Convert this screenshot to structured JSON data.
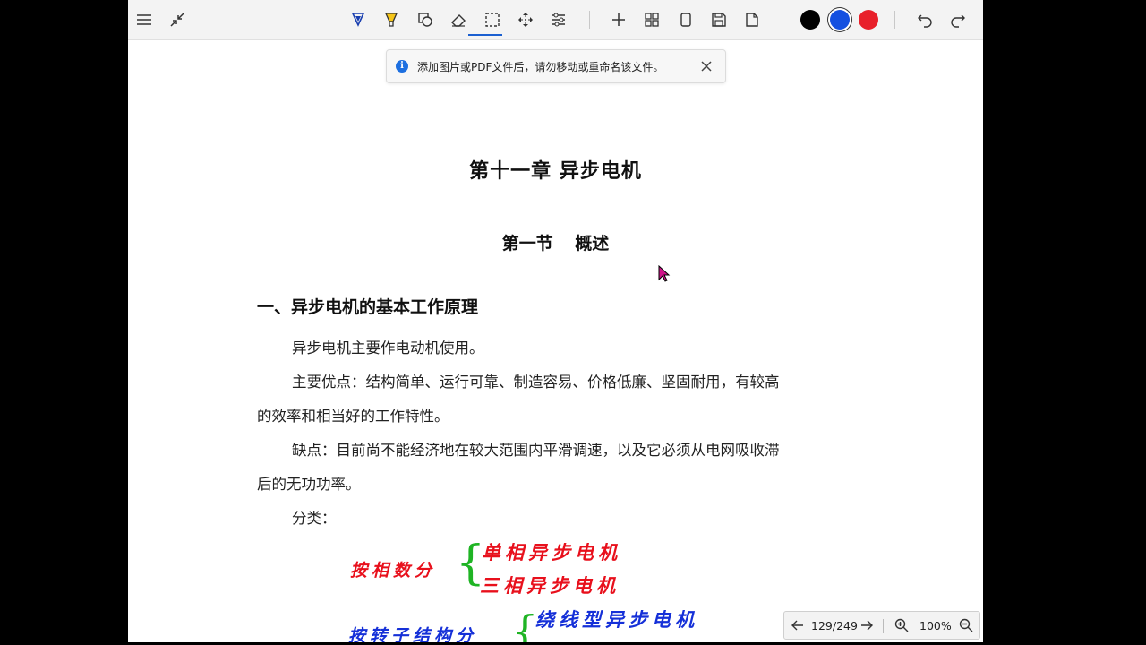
{
  "toolbar": {
    "left_buttons": [
      "menu",
      "collapse"
    ],
    "tools": [
      "pen",
      "highlighter",
      "shapes",
      "eraser",
      "lasso-select",
      "move",
      "adjust"
    ],
    "actions": [
      "add",
      "grid",
      "page",
      "save",
      "export"
    ],
    "colors": [
      "#000000",
      "#1450e0",
      "#e8202a"
    ],
    "selected_color": "#1450e0"
  },
  "notice": {
    "message": "添加图片或PDF文件后，请勿移动或重命名该文件。"
  },
  "document": {
    "chapter_title": "第十一章  异步电机",
    "section_title": "第一节 概述",
    "heading": "一、异步电机的基本工作原理",
    "lines": [
      "异步电机主要作电动机使用。",
      "主要优点：结构简单、运行可靠、制造容易、价格低廉、坚固耐用，有较高",
      "的效率和相当好的工作特性。",
      "缺点：目前尚不能经济地在较大范围内平滑调速，以及它必须从电网吸收滞",
      "后的无功功率。",
      "分类："
    ],
    "annotations": {
      "by_phase": "按相数分",
      "single_phase": "单相异步电机",
      "three_phase": "三相异步电机",
      "by_rotor": "按转子结构分",
      "wound_rotor": "绕线型异步电机"
    }
  },
  "pager": {
    "page": "129/249",
    "zoom": "100%"
  }
}
